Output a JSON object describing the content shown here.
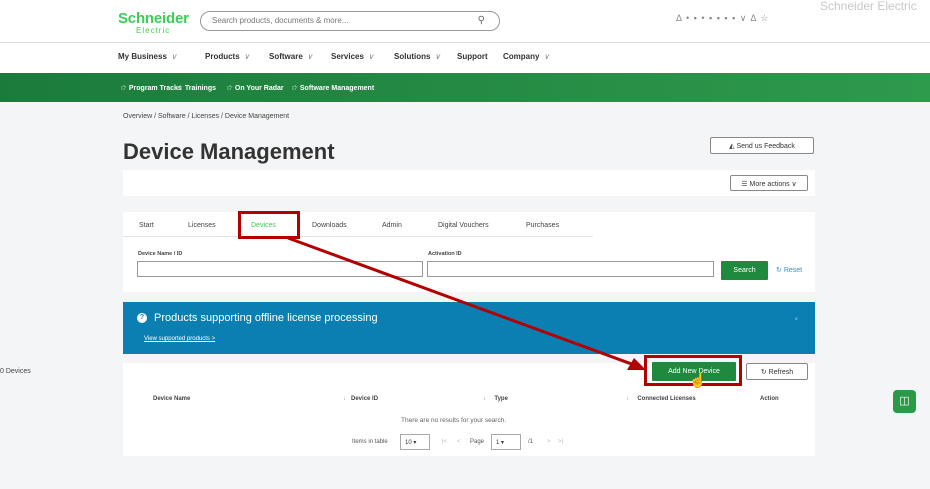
{
  "header": {
    "logo_line1": "Schneider",
    "logo_line2": "Electric",
    "search_placeholder": "Search products, documents & more...",
    "ghost_logo": "Schneider Electric",
    "top_icons": "Δ • ▪ • ▪ ▪ ▪ ▪ ∨  Δ  ☆"
  },
  "nav": [
    {
      "label": "My Business",
      "chev": true
    },
    {
      "label": "Products",
      "chev": true
    },
    {
      "label": "Software",
      "chev": true
    },
    {
      "label": "Services",
      "chev": true
    },
    {
      "label": "Solutions",
      "chev": true
    },
    {
      "label": "Support",
      "chev": false
    },
    {
      "label": "Company",
      "chev": true
    }
  ],
  "green_nav": [
    "Program Tracks",
    "Trainings",
    "On Your Radar",
    "Software Management"
  ],
  "breadcrumb": "Overview / Software / Licenses / Device Management",
  "page_title": "Device Management",
  "feedback_button": "Send us Feedback",
  "more_actions": "More actions",
  "tabs": [
    "Start",
    "Licenses",
    "Devices",
    "Downloads",
    "Admin",
    "Digital Vouchers",
    "Purchases"
  ],
  "active_tab": "Devices",
  "filters": {
    "device_label": "Device Name / ID",
    "activation_label": "Activation ID",
    "search_button": "Search",
    "reset": "Reset"
  },
  "banner": {
    "title": "Products supporting offline license processing",
    "link": "View supported products >",
    "close": "×"
  },
  "device_count": "0 Devices",
  "add_button": "Add New Device",
  "refresh_button": "Refresh",
  "columns": [
    "Device Name",
    "Device ID",
    "Type",
    "Connected Licenses",
    "Action"
  ],
  "empty_message": "There are no results for your search.",
  "pager": {
    "items_label": "Items in table",
    "items_value": "10",
    "page_label": "Page",
    "page_value": "1",
    "page_total": "/1"
  },
  "colors": {
    "brand_green": "#3dcd58",
    "dark_green": "#1f8a3e",
    "banner_blue": "#0b7fb1",
    "highlight_red": "#b30000"
  }
}
